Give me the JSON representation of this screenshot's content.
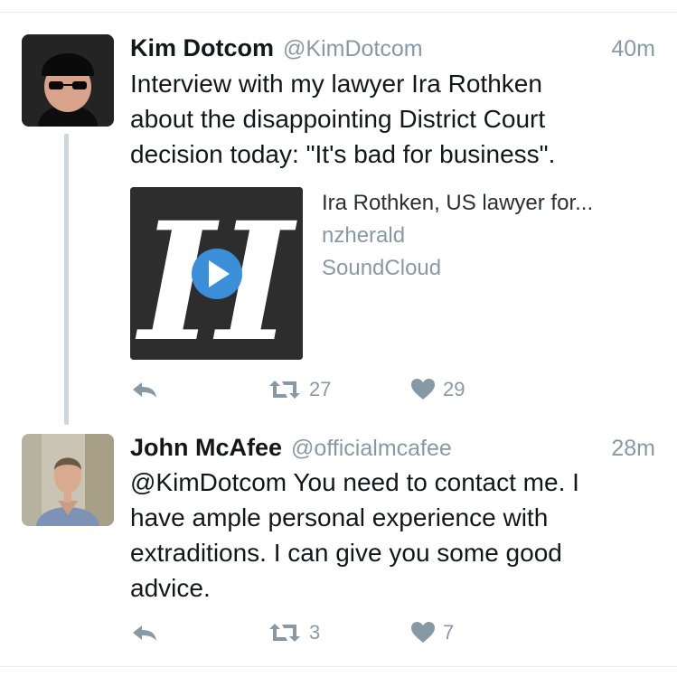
{
  "tweets": [
    {
      "name": "Kim Dotcom",
      "handle": "@KimDotcom",
      "time": "40m",
      "lines": [
        "Interview with my lawyer Ira Rothken",
        "about the disappointing District Court",
        "decision today: \"It's bad for business\"."
      ],
      "card": {
        "title": "Ira Rothken, US lawyer for...",
        "source": "nzherald",
        "provider": "SoundCloud",
        "logo_glyph": "H"
      },
      "retweets": "27",
      "likes": "29"
    },
    {
      "name": "John McAfee",
      "handle": "@officialmcafee",
      "time": "28m",
      "lines": [
        "@KimDotcom You need to contact me. I",
        "have ample personal experience with",
        "extraditions. I can give you some good",
        "advice."
      ],
      "retweets": "3",
      "likes": "7"
    }
  ],
  "icons": {
    "reply": "reply-icon",
    "retweet": "retweet-icon",
    "like": "heart-icon",
    "play": "play-icon"
  },
  "colors": {
    "text": "#14171a",
    "muted": "#8899a6",
    "thread_line": "#ccd6dd",
    "play_blue": "#3b8fd9"
  }
}
